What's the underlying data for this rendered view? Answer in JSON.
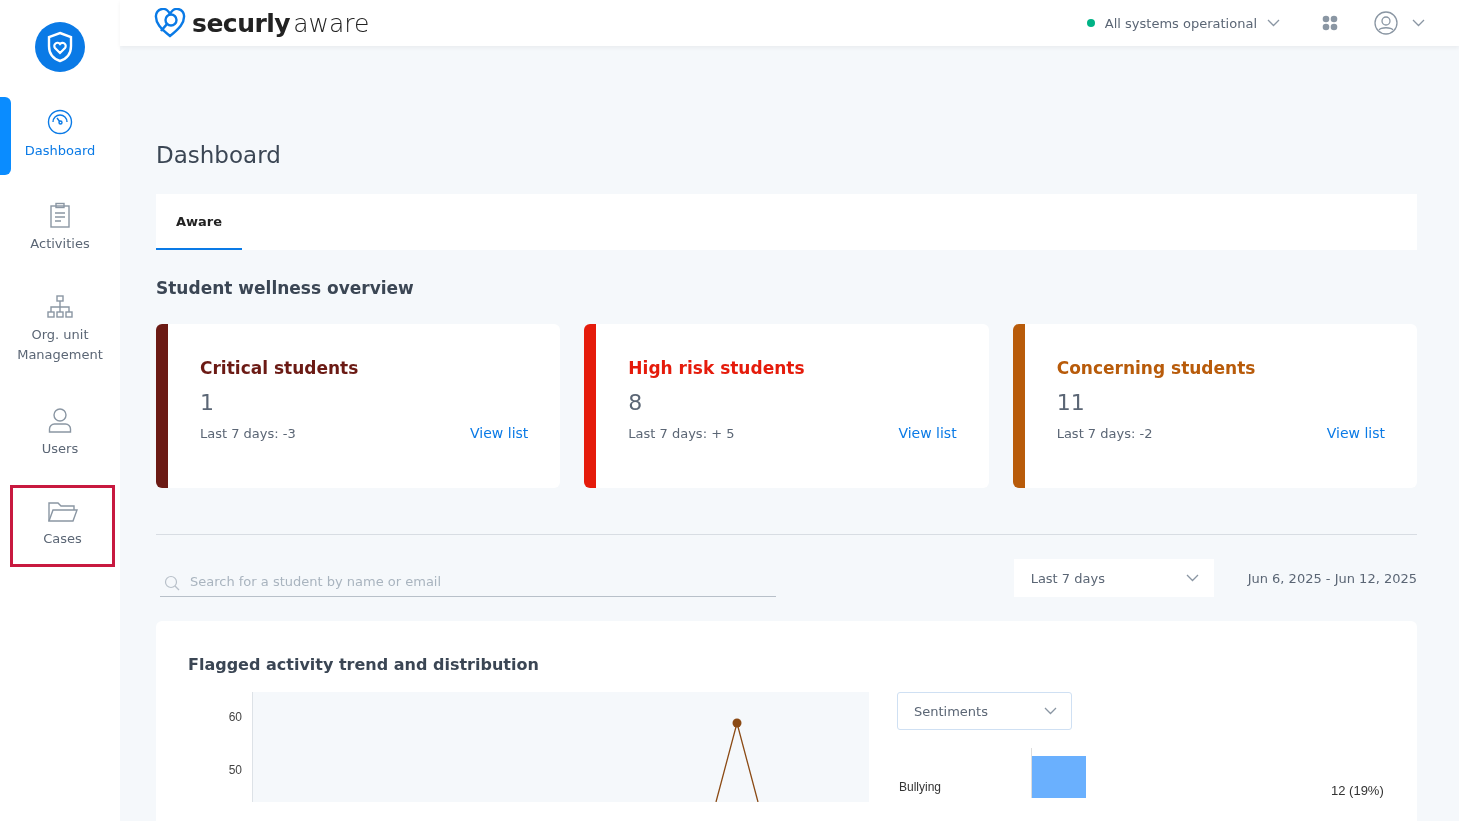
{
  "sidebar": {
    "items": [
      {
        "kind": "gauge",
        "label": "Dashboard",
        "selected": true,
        "highlighted": false
      },
      {
        "kind": "clipboard",
        "label": "Activities",
        "selected": false,
        "highlighted": false
      },
      {
        "kind": "org",
        "label": "Org. unit Management",
        "selected": false,
        "highlighted": false
      },
      {
        "kind": "user",
        "label": "Users",
        "selected": false,
        "highlighted": false
      },
      {
        "kind": "folder",
        "label": "Cases",
        "selected": false,
        "highlighted": true
      }
    ]
  },
  "header": {
    "brand_bold": "securly",
    "brand_light": "aware",
    "status": {
      "label": "All systems operational",
      "color": "#00b386"
    }
  },
  "page": {
    "title": "Dashboard",
    "tabs": [
      {
        "label": "Aware",
        "selected": true
      }
    ],
    "section_title": "Student wellness overview",
    "cards": [
      {
        "title": "Critical students",
        "count": "1",
        "change": "Last 7 days: -3",
        "link": "View list",
        "color": "#6b1a14"
      },
      {
        "title": "High risk students",
        "count": "8",
        "change": "Last 7 days: + 5",
        "link": "View list",
        "color": "#e51b0b"
      },
      {
        "title": "Concerning students",
        "count": "11",
        "change": "Last 7 days: -2",
        "link": "View list",
        "color": "#b85b0a"
      }
    ],
    "search": {
      "placeholder": "Search for a student by name or email"
    },
    "range_select": "Last 7 days",
    "date_range": "Jun 6, 2025 - Jun 12, 2025",
    "chart_card": {
      "title": "Flagged activity trend and distribution",
      "y_tick_labels": [
        "60",
        "50"
      ],
      "category_select": "Sentiments",
      "bars": [
        {
          "label": "Bullying",
          "value": "12 (19%)",
          "level": 0.19
        }
      ]
    }
  }
}
